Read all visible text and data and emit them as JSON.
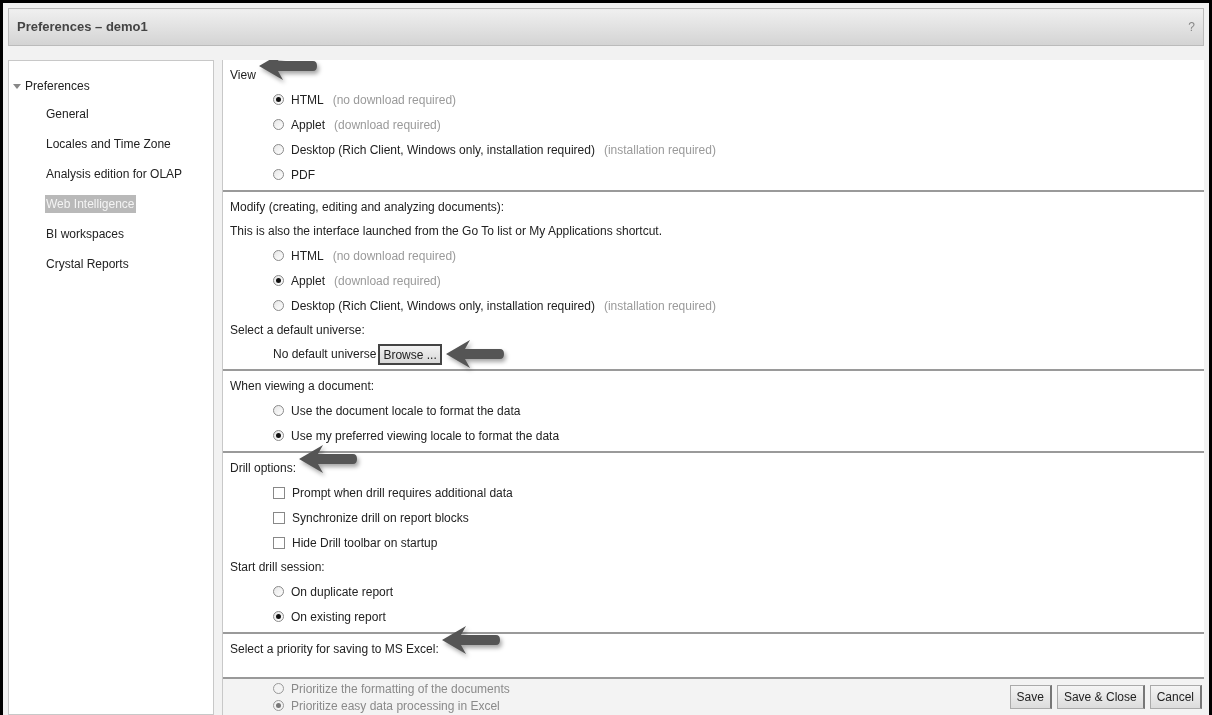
{
  "window": {
    "title": "Preferences – demo1",
    "help": "?"
  },
  "sidebar": {
    "root": {
      "label": "Preferences",
      "expanded": true,
      "children": [
        {
          "label": "General",
          "selected": false
        },
        {
          "label": "Locales and Time Zone",
          "selected": false
        },
        {
          "label": "Analysis edition for OLAP",
          "selected": false
        },
        {
          "label": "Web Intelligence",
          "selected": true
        },
        {
          "label": "BI workspaces",
          "selected": false
        },
        {
          "label": "Crystal Reports",
          "selected": false
        }
      ]
    }
  },
  "groups": [
    {
      "items": [
        {
          "kind": "heading",
          "text": "View",
          "callout": true
        },
        {
          "kind": "radio",
          "label": "HTML",
          "note": "(no download required)",
          "selected": true
        },
        {
          "kind": "radio",
          "label": "Applet",
          "note": "(download required)",
          "selected": false
        },
        {
          "kind": "radio",
          "label": "Desktop (Rich Client, Windows only, installation required)",
          "note": "(installation required)",
          "selected": false
        },
        {
          "kind": "radio",
          "label": "PDF",
          "selected": false
        }
      ]
    },
    {
      "items": [
        {
          "kind": "heading",
          "text": "Modify (creating, editing and analyzing documents):",
          "callout": false
        },
        {
          "kind": "heading",
          "text": "This is also the interface launched from the Go To list or My Applications shortcut.",
          "callout": false
        },
        {
          "kind": "radio",
          "label": "HTML",
          "note": "(no download required)",
          "selected": false
        },
        {
          "kind": "radio",
          "label": "Applet",
          "note": "(download required)",
          "selected": true
        },
        {
          "kind": "radio",
          "label": "Desktop (Rich Client, Windows only, installation required)",
          "note": "(installation required)",
          "selected": false
        },
        {
          "kind": "heading",
          "text": "Select a default universe:",
          "callout": false
        },
        {
          "kind": "universe",
          "text": "No default universe",
          "button": "Browse ...",
          "callout": true
        }
      ]
    },
    {
      "items": [
        {
          "kind": "heading",
          "text": "When viewing a document:",
          "callout": false
        },
        {
          "kind": "radio",
          "label": "Use the document locale to format the data",
          "selected": false
        },
        {
          "kind": "radio",
          "label": "Use my preferred viewing locale to format the data",
          "selected": true
        }
      ]
    },
    {
      "items": [
        {
          "kind": "heading",
          "text": "Drill options:",
          "callout": true
        },
        {
          "kind": "checkbox",
          "label": "Prompt when drill requires additional data",
          "checked": false
        },
        {
          "kind": "checkbox",
          "label": "Synchronize drill on report blocks",
          "checked": false
        },
        {
          "kind": "checkbox",
          "label": "Hide Drill toolbar on startup",
          "checked": false
        },
        {
          "kind": "heading",
          "text": "Start drill session:",
          "callout": false
        },
        {
          "kind": "radio",
          "label": "On duplicate report",
          "selected": false
        },
        {
          "kind": "radio",
          "label": "On existing report",
          "selected": true
        }
      ]
    },
    {
      "items": [
        {
          "kind": "heading",
          "text": "Select a priority for saving to MS Excel:",
          "callout": true
        },
        {
          "kind": "radio",
          "label": "Prioritize the formatting of the documents",
          "selected": false,
          "obscured": true
        },
        {
          "kind": "radio",
          "label": "Prioritize easy data processing in Excel",
          "selected": true,
          "obscured": true
        }
      ]
    }
  ],
  "buttons": [
    "Save",
    "Save & Close",
    "Cancel"
  ]
}
